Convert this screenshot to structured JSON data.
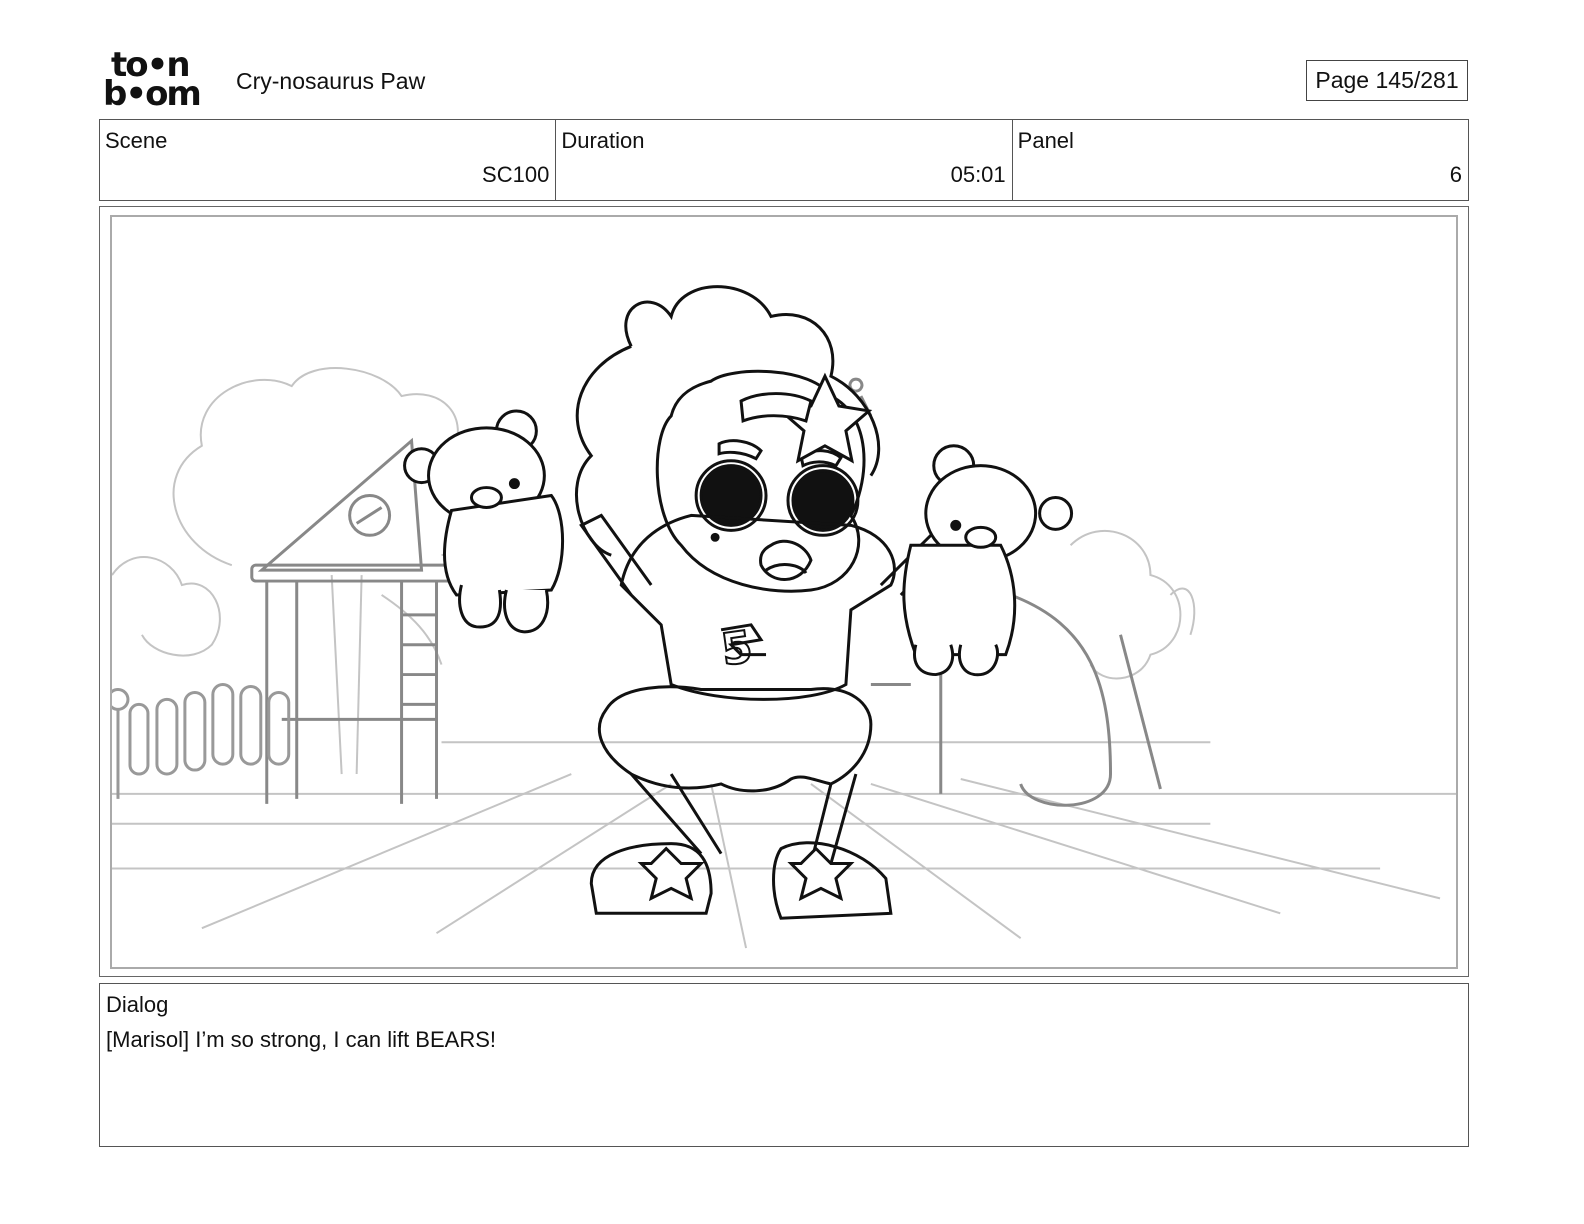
{
  "header": {
    "logo_line1": "to•n",
    "logo_line2": "b•om",
    "project_title": "Cry-nosaurus Paw",
    "page_indicator": "Page 145/281"
  },
  "info": {
    "scene_label": "Scene",
    "scene_value": "SC100",
    "duration_label": "Duration",
    "duration_value": "05:01",
    "panel_label": "Panel",
    "panel_value": "6"
  },
  "panel": {
    "jersey_number": "5"
  },
  "dialog": {
    "label": "Dialog",
    "text": "[Marisol] I’m so strong, I can lift BEARS!"
  }
}
